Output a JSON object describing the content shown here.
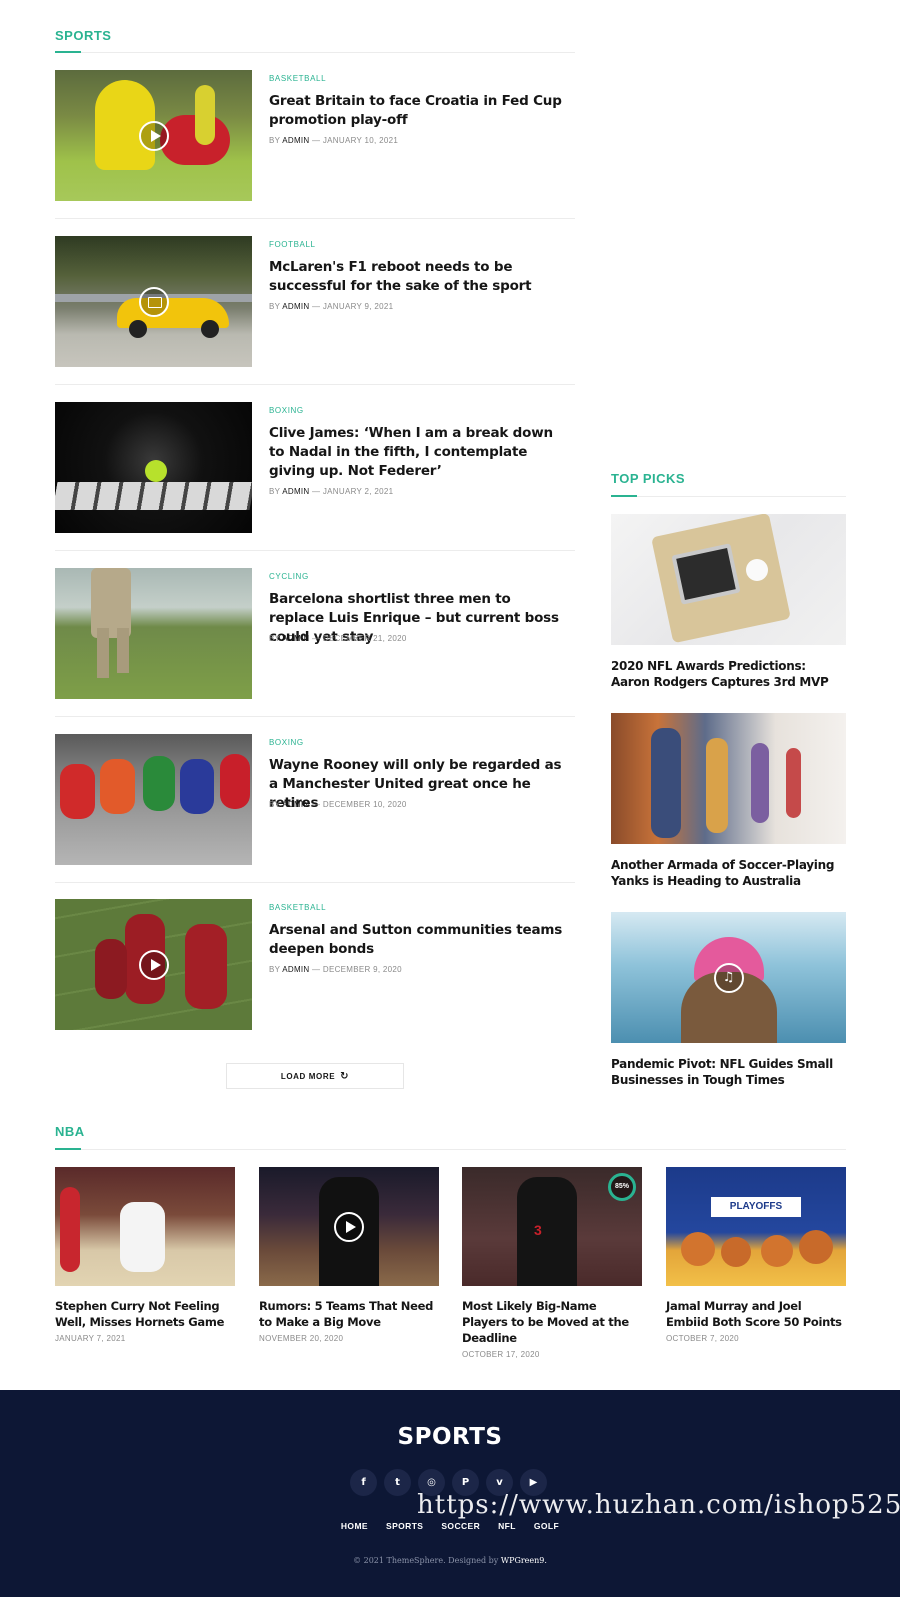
{
  "sports": {
    "title": "SPORTS",
    "posts": [
      {
        "category": "BASKETBALL",
        "title": "Great Britain to face Croatia in Fed Cup promotion play-off",
        "by": "BY",
        "author": "ADMIN",
        "date": "— JANUARY 10, 2021",
        "icon": "play-icon"
      },
      {
        "category": "FOOTBALL",
        "title": "McLaren's F1 reboot needs to be successful for the sake of the sport",
        "by": "BY",
        "author": "ADMIN",
        "date": "— JANUARY 9, 2021",
        "icon": "gallery-icon"
      },
      {
        "category": "BOXING",
        "title": "Clive James: ‘When I am a break down to Nadal in the fifth, I contemplate giving up. Not Federer’",
        "by": "BY",
        "author": "ADMIN",
        "date": "— JANUARY 2, 2021",
        "icon": ""
      },
      {
        "category": "CYCLING",
        "title": "Barcelona shortlist three men to replace Luis Enrique – but current boss could yet stay",
        "by": "BY",
        "author": "ADMIN",
        "date": "— DECEMBER 21, 2020",
        "icon": ""
      },
      {
        "category": "BOXING",
        "title": "Wayne Rooney will only be regarded as a Manchester United great once he retires",
        "by": "BY",
        "author": "ADMIN",
        "date": "— DECEMBER 10, 2020",
        "icon": ""
      },
      {
        "category": "BASKETBALL",
        "title": "Arsenal and Sutton communities teams deepen bonds",
        "by": "BY",
        "author": "ADMIN",
        "date": "— DECEMBER 9, 2020",
        "icon": "play-icon"
      }
    ],
    "load_more": "LOAD MORE"
  },
  "top_picks": {
    "title": "TOP PICKS",
    "items": [
      {
        "title": "2020 NFL Awards Predictions: Aaron Rodgers Captures 3rd MVP"
      },
      {
        "title": "Another Armada of Soccer-Playing Yanks is Heading to Australia"
      },
      {
        "title": "Pandemic Pivot: NFL Guides Small Businesses in Tough Times"
      }
    ]
  },
  "nba": {
    "title": "NBA",
    "items": [
      {
        "title": "Stephen Curry Not Feeling Well, Misses Hornets Game",
        "date": "JANUARY 7, 2021"
      },
      {
        "title": "Rumors: 5 Teams That Need to Make a Big Move",
        "date": "NOVEMBER 20, 2020"
      },
      {
        "title": "Most Likely Big-Name Players to be Moved at the Deadline",
        "date": "OCTOBER 17, 2020",
        "score": "85%"
      },
      {
        "title": "Jamal Murray and Joel Embiid Both Score 50 Points",
        "date": "OCTOBER 7, 2020"
      }
    ]
  },
  "footer": {
    "logo": "SPORTS",
    "socials": [
      "facebook-icon",
      "twitter-icon",
      "instagram-icon",
      "pinterest-icon",
      "vimeo-icon",
      "youtube-icon"
    ],
    "nav": [
      "HOME",
      "SPORTS",
      "SOCCER",
      "NFL",
      "GOLF"
    ],
    "copyright": "© 2021 ThemeSphere. Designed by",
    "designer": "WPGreen9."
  },
  "watermark": "https://www.huzhan.com/ishop525",
  "colors": {
    "accent": "#2ab391",
    "footer_bg": "#0d1735",
    "text": "#161616",
    "meta": "#8a8a8a"
  }
}
